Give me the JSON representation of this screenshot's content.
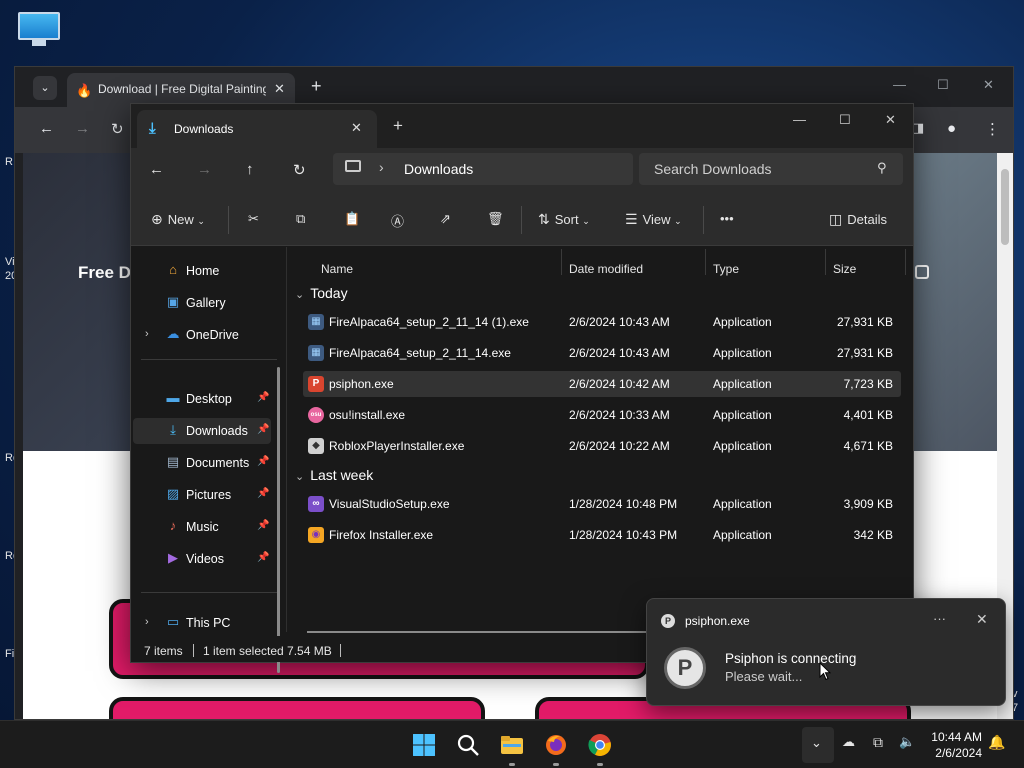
{
  "desktop": {
    "side_labels": [
      "R",
      "Vi",
      "20",
      "Ro",
      "Ro",
      "Fi"
    ],
    "right_labels": [
      "v",
      "7"
    ]
  },
  "browser": {
    "tab_title": "Download | Free Digital Painting",
    "page_heading": "Free Di"
  },
  "explorer": {
    "tab_title": "Downloads",
    "breadcrumb": "Downloads",
    "search_placeholder": "Search Downloads",
    "commands": {
      "new": "New",
      "sort": "Sort",
      "view": "View",
      "more": "•••",
      "details": "Details"
    },
    "nav": {
      "home": "Home",
      "gallery": "Gallery",
      "onedrive": "OneDrive",
      "desktop": "Desktop",
      "downloads": "Downloads",
      "documents": "Documents",
      "pictures": "Pictures",
      "music": "Music",
      "videos": "Videos",
      "this_pc": "This PC"
    },
    "columns": {
      "name": "Name",
      "date": "Date modified",
      "type": "Type",
      "size": "Size"
    },
    "groups": {
      "today": "Today",
      "last_week": "Last week"
    },
    "files": [
      {
        "name": "FireAlpaca64_setup_2_11_14 (1).exe",
        "date": "2/6/2024 10:43 AM",
        "type": "Application",
        "size": "27,931 KB",
        "icon": "firealpaca-icon"
      },
      {
        "name": "FireAlpaca64_setup_2_11_14.exe",
        "date": "2/6/2024 10:43 AM",
        "type": "Application",
        "size": "27,931 KB",
        "icon": "firealpaca-icon"
      },
      {
        "name": "psiphon.exe",
        "date": "2/6/2024 10:42 AM",
        "type": "Application",
        "size": "7,723 KB",
        "icon": "psiphon-icon",
        "selected": true
      },
      {
        "name": "osu!install.exe",
        "date": "2/6/2024 10:33 AM",
        "type": "Application",
        "size": "4,401 KB",
        "icon": "osu-icon"
      },
      {
        "name": "RobloxPlayerInstaller.exe",
        "date": "2/6/2024 10:22 AM",
        "type": "Application",
        "size": "4,671 KB",
        "icon": "roblox-icon"
      },
      {
        "name": "VisualStudioSetup.exe",
        "date": "1/28/2024 10:48 PM",
        "type": "Application",
        "size": "3,909 KB",
        "icon": "visualstudio-icon"
      },
      {
        "name": "Firefox Installer.exe",
        "date": "1/28/2024 10:43 PM",
        "type": "Application",
        "size": "342 KB",
        "icon": "firefox-icon"
      }
    ],
    "status": {
      "items": "7 items",
      "selection": "1 item selected  7.54 MB"
    }
  },
  "toast": {
    "app_name": "psiphon.exe",
    "more": "···",
    "title": "Psiphon is connecting",
    "body": "Please wait..."
  },
  "taskbar": {
    "time": "10:44 AM",
    "date": "2/6/2024"
  },
  "colors": {
    "accent": "#4cc2ff",
    "pink": "#e21b68"
  }
}
